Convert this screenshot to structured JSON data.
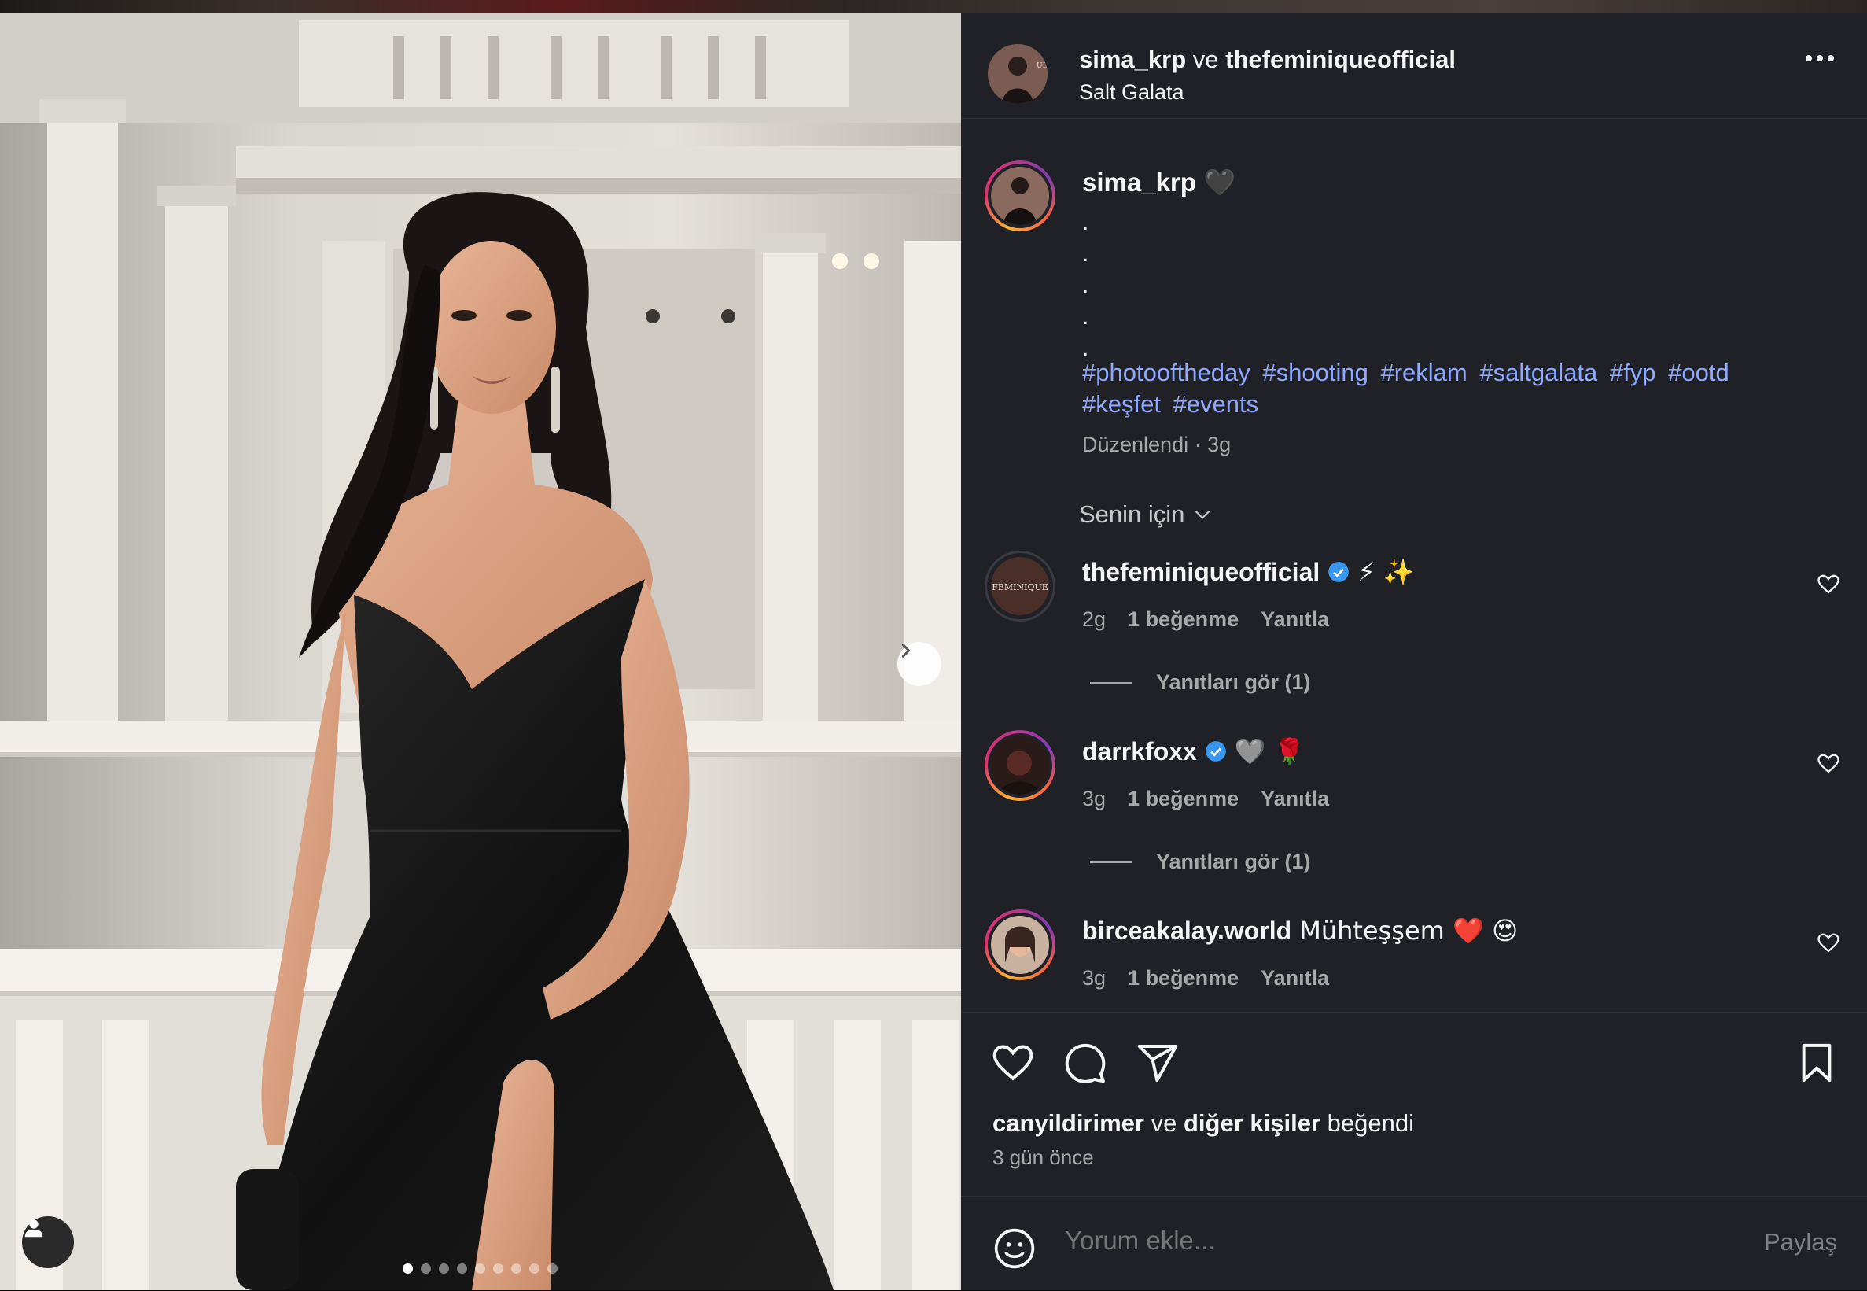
{
  "post": {
    "header": {
      "author": "sima_krp",
      "connector": "ve",
      "collaborator": "thefeminiqueofficial",
      "location": "Salt Galata"
    },
    "caption": {
      "username": "sima_krp",
      "emoji": "🖤",
      "dots": [
        ".",
        ".",
        ".",
        ".",
        "."
      ],
      "hashtags": [
        "#photooftheday",
        "#shooting",
        "#reklam",
        "#saltgalata",
        "#fyp",
        "#ootd",
        "#keşfet",
        "#events"
      ],
      "meta": "Düzenlendi · 3g"
    },
    "comments_filter": "Senin için",
    "comments": [
      {
        "username": "thefeminiqueofficial",
        "verified": true,
        "text": "⚡ ✨",
        "age": "2g",
        "likes": "1 beğenme",
        "reply": "Yanıtla",
        "view_replies": "Yanıtları gör (1)"
      },
      {
        "username": "darrkfoxx",
        "verified": true,
        "text": "🩶 🌹",
        "age": "3g",
        "likes": "1 beğenme",
        "reply": "Yanıtla",
        "view_replies": "Yanıtları gör (1)"
      },
      {
        "username": "birceakalay.world",
        "verified": false,
        "text": "Mühteşşem ❤️ 😍",
        "age": "3g",
        "likes": "1 beğenme",
        "reply": "Yanıtla"
      }
    ],
    "likes_line": {
      "user": "canyildirimer",
      "connector": "ve",
      "others": "diğer kişiler",
      "suffix": "beğendi"
    },
    "time_ago": "3 gün önce",
    "comment_input": {
      "placeholder": "Yorum ekle..."
    },
    "share_label": "Paylaş",
    "avatar_label": "FEMINIQUE",
    "carousel": {
      "slides": 9,
      "current": 1
    },
    "icons": {
      "like": "heart-icon",
      "comment": "comment-icon",
      "share": "send-icon",
      "save": "bookmark-icon",
      "emoji": "emoji-icon",
      "next": "chevron-right-icon",
      "tag": "user-tag-icon",
      "more": "more-options-icon"
    },
    "colors": {
      "panel_bg": "#202126",
      "hashtag": "#8ea8ff",
      "muted": "#a8a8a8",
      "verified": "#3897f0"
    }
  }
}
